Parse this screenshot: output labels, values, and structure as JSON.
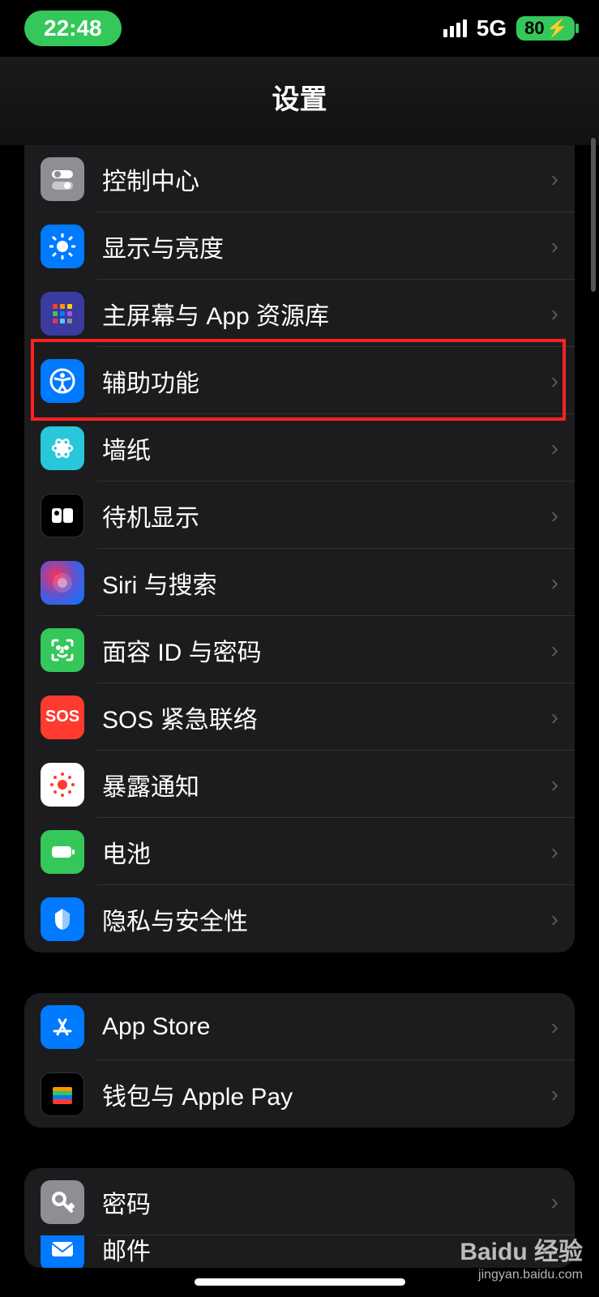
{
  "status": {
    "time": "22:48",
    "network": "5G",
    "battery": "80"
  },
  "header": {
    "title": "设置"
  },
  "groups": [
    {
      "rows": [
        {
          "id": "control-center",
          "label": "控制中心",
          "icon": "control-center-icon",
          "iconClass": "ic-control",
          "highlighted": false
        },
        {
          "id": "display",
          "label": "显示与亮度",
          "icon": "brightness-icon",
          "iconClass": "ic-display",
          "highlighted": false
        },
        {
          "id": "home-screen",
          "label": "主屏幕与 App 资源库",
          "icon": "home-screen-icon",
          "iconClass": "ic-home",
          "highlighted": false
        },
        {
          "id": "accessibility",
          "label": "辅助功能",
          "icon": "accessibility-icon",
          "iconClass": "ic-access",
          "highlighted": true
        },
        {
          "id": "wallpaper",
          "label": "墙纸",
          "icon": "wallpaper-icon",
          "iconClass": "ic-wallpaper",
          "highlighted": false
        },
        {
          "id": "standby",
          "label": "待机显示",
          "icon": "standby-icon",
          "iconClass": "ic-standby",
          "highlighted": false
        },
        {
          "id": "siri",
          "label": "Siri 与搜索",
          "icon": "siri-icon",
          "iconClass": "ic-siri",
          "highlighted": false
        },
        {
          "id": "faceid",
          "label": "面容 ID 与密码",
          "icon": "faceid-icon",
          "iconClass": "ic-faceid",
          "highlighted": false
        },
        {
          "id": "sos",
          "label": "SOS 紧急联络",
          "icon": "sos-icon",
          "iconClass": "ic-sos",
          "highlighted": false
        },
        {
          "id": "exposure",
          "label": "暴露通知",
          "icon": "exposure-icon",
          "iconClass": "ic-exposure",
          "highlighted": false
        },
        {
          "id": "battery",
          "label": "电池",
          "icon": "battery-icon",
          "iconClass": "ic-battery",
          "highlighted": false
        },
        {
          "id": "privacy",
          "label": "隐私与安全性",
          "icon": "privacy-icon",
          "iconClass": "ic-privacy",
          "highlighted": false
        }
      ]
    },
    {
      "rows": [
        {
          "id": "appstore",
          "label": "App Store",
          "icon": "appstore-icon",
          "iconClass": "ic-appstore",
          "highlighted": false
        },
        {
          "id": "wallet",
          "label": "钱包与 Apple Pay",
          "icon": "wallet-icon",
          "iconClass": "ic-wallet",
          "highlighted": false
        }
      ]
    },
    {
      "rows": [
        {
          "id": "passwords",
          "label": "密码",
          "icon": "passwords-icon",
          "iconClass": "ic-passwords",
          "highlighted": false
        },
        {
          "id": "mail",
          "label": "邮件",
          "icon": "mail-icon",
          "iconClass": "ic-mail",
          "highlighted": false
        }
      ]
    }
  ],
  "watermark": {
    "line1": "Baidu 经验",
    "line2": "jingyan.baidu.com"
  },
  "icons_svg": {
    "control-center-icon": "<rect x='4' y='6' width='26' height='10' rx='5' fill='#fff'/><circle cx='11' cy='11' r='4' fill='#8e8e93'/><rect x='4' y='20' width='26' height='10' rx='5' fill='#c7c7cc'/><circle cx='23' cy='25' r='4' fill='#fff'/>",
    "brightness-icon": "<circle cx='17' cy='17' r='7' fill='#fff'/><g stroke='#fff' stroke-width='3'><line x1='17' y1='1' x2='17' y2='6'/><line x1='17' y1='28' x2='17' y2='33'/><line x1='1' y1='17' x2='6' y2='17'/><line x1='28' y1='17' x2='33' y2='17'/><line x1='5' y1='5' x2='9' y2='9'/><line x1='25' y1='25' x2='29' y2='29'/><line x1='25' y1='9' x2='29' y2='5'/><line x1='5' y1='29' x2='9' y2='25'/></g>",
    "home-screen-icon": "<rect x='5' y='5' width='6' height='6' rx='1' fill='#ff3b30'/><rect x='14' y='5' width='6' height='6' rx='1' fill='#ff9500'/><rect x='23' y='5' width='6' height='6' rx='1' fill='#ffcc00'/><rect x='5' y='14' width='6' height='6' rx='1' fill='#34c759'/><rect x='14' y='14' width='6' height='6' rx='1' fill='#007aff'/><rect x='23' y='14' width='6' height='6' rx='1' fill='#af52de'/><rect x='5' y='23' width='6' height='6' rx='1' fill='#ff2d55'/><rect x='14' y='23' width='6' height='6' rx='1' fill='#5ac8fa'/><rect x='23' y='23' width='6' height='6' rx='1' fill='#8e8e93'/>",
    "accessibility-icon": "<circle cx='17' cy='17' r='14' fill='none' stroke='#fff' stroke-width='3'/><circle cx='17' cy='10' r='3' fill='#fff'/><path d='M8 14 L17 16 L26 14 M17 16 L17 22 M17 22 L12 30 M17 22 L22 30' stroke='#fff' stroke-width='3' fill='none' stroke-linecap='round'/>",
    "wallpaper-icon": "<circle cx='17' cy='17' r='4' fill='#fff'/><g fill='none' stroke='#fff' stroke-width='2.5'><ellipse cx='17' cy='17' rx='12' ry='5'/><ellipse cx='17' cy='17' rx='12' ry='5' transform='rotate(60 17 17)'/><ellipse cx='17' cy='17' rx='12' ry='5' transform='rotate(120 17 17)'/></g>",
    "standby-icon": "<rect x='4' y='8' width='12' height='18' rx='3' fill='#fff'/><circle cx='10' cy='14' r='3' fill='#000'/><rect x='18' y='8' width='12' height='18' rx='3' fill='#fff'/>",
    "siri-icon": "<circle cx='17' cy='17' r='12' fill='rgba(255,255,255,0.15)'/><circle cx='17' cy='17' r='6' fill='rgba(255,255,255,0.4)'/>",
    "faceid-icon": "<g fill='none' stroke='#fff' stroke-width='3' stroke-linecap='round'><path d='M5 11 V7 Q5 5 7 5 H11'/><path d='M29 11 V7 Q29 5 27 5 H23'/><path d='M5 23 V27 Q5 29 7 29 H11'/><path d='M29 23 V27 Q29 29 27 29 H23'/><circle cx='12' cy='14' r='1.5' fill='#fff'/><circle cx='22' cy='14' r='1.5' fill='#fff'/><path d='M17 14 V19 H15'/><path d='M12 23 Q17 27 22 23'/></g>",
    "sos-icon": "",
    "exposure-icon": "<circle cx='17' cy='17' r='6' fill='#ff3b30'/><g fill='#ff3b30'><circle cx='17' cy='4' r='2'/><circle cx='17' cy='30' r='2'/><circle cx='4' cy='17' r='2'/><circle cx='30' cy='17' r='2'/><circle cx='8' cy='8' r='2'/><circle cx='26' cy='8' r='2'/><circle cx='8' cy='26' r='2'/><circle cx='26' cy='26' r='2'/></g>",
    "battery-icon": "<rect x='4' y='10' width='24' height='14' rx='4' fill='#fff'/><rect x='29' y='14' width='3' height='6' rx='1' fill='#fff'/>",
    "privacy-icon": "<path d='M17 4 L17 30 Q8 28 8 18 V10 L17 4' fill='#fff'/><path d='M17 4 L26 10 V18 Q26 28 17 30' fill='rgba(255,255,255,0.6)'/>",
    "appstore-icon": "<g stroke='#fff' stroke-width='3' stroke-linecap='round'><line x1='13' y1='8' x2='23' y2='26'/><line x1='21' y1='8' x2='11' y2='26'/><line x1='7' y1='22' x2='27' y2='22'/></g>",
    "wallet-icon": "<rect x='5' y='8' width='24' height='6' rx='2' fill='#ff9500'/><rect x='5' y='13' width='24' height='6' rx='2' fill='#34c759'/><rect x='5' y='18' width='24' height='6' rx='2' fill='#007aff'/><rect x='5' y='23' width='24' height='6' rx='2' fill='#ff3b30'/>",
    "passwords-icon": "<circle cx='13' cy='13' r='7' fill='none' stroke='#fff' stroke-width='4'/><path d='M18 18 L28 28 M24 24 L28 20 M26 26 L30 22' stroke='#fff' stroke-width='4' stroke-linecap='round'/>",
    "mail-icon": "<rect x='4' y='8' width='26' height='18' rx='3' fill='#fff'/><path d='M4 10 L17 20 L30 10' stroke='#007aff' stroke-width='2' fill='none'/>"
  }
}
